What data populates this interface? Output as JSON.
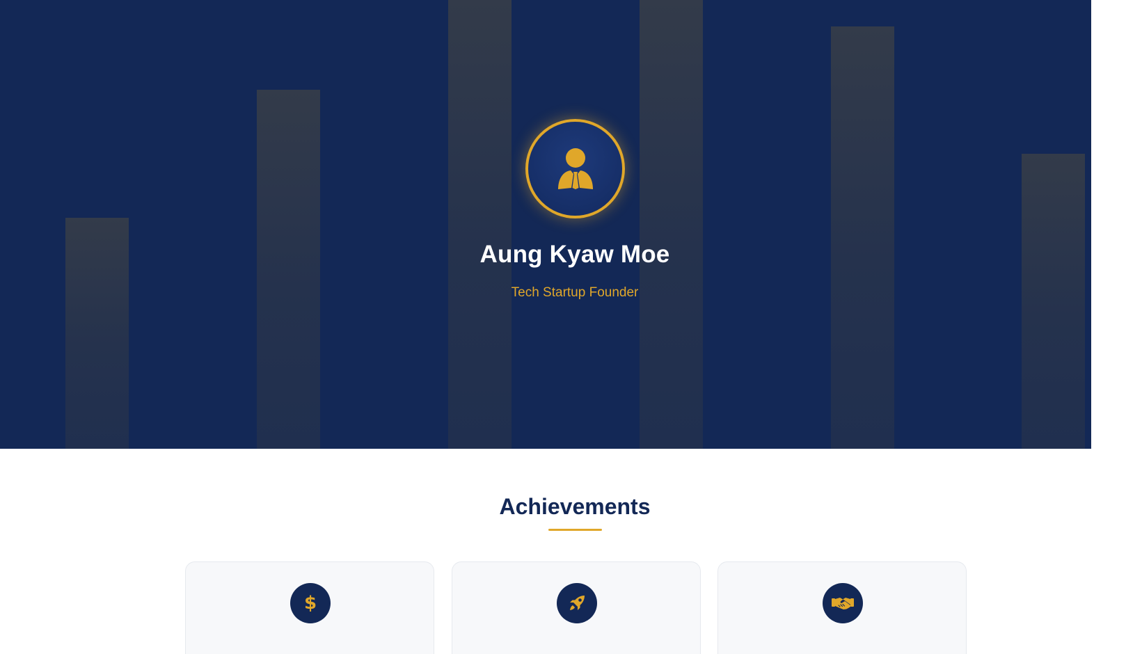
{
  "hero": {
    "name": "Aung Kyaw Moe",
    "role": "Tech Startup Founder",
    "avatar_icon": "user-tie-icon"
  },
  "achievements": {
    "title": "Achievements",
    "cards": [
      {
        "icon": "dollar-icon"
      },
      {
        "icon": "rocket-icon"
      },
      {
        "icon": "handshake-icon"
      }
    ]
  },
  "colors": {
    "navy": "#132856",
    "gold": "#e0a72a",
    "card_bg": "#f7f8fa"
  }
}
